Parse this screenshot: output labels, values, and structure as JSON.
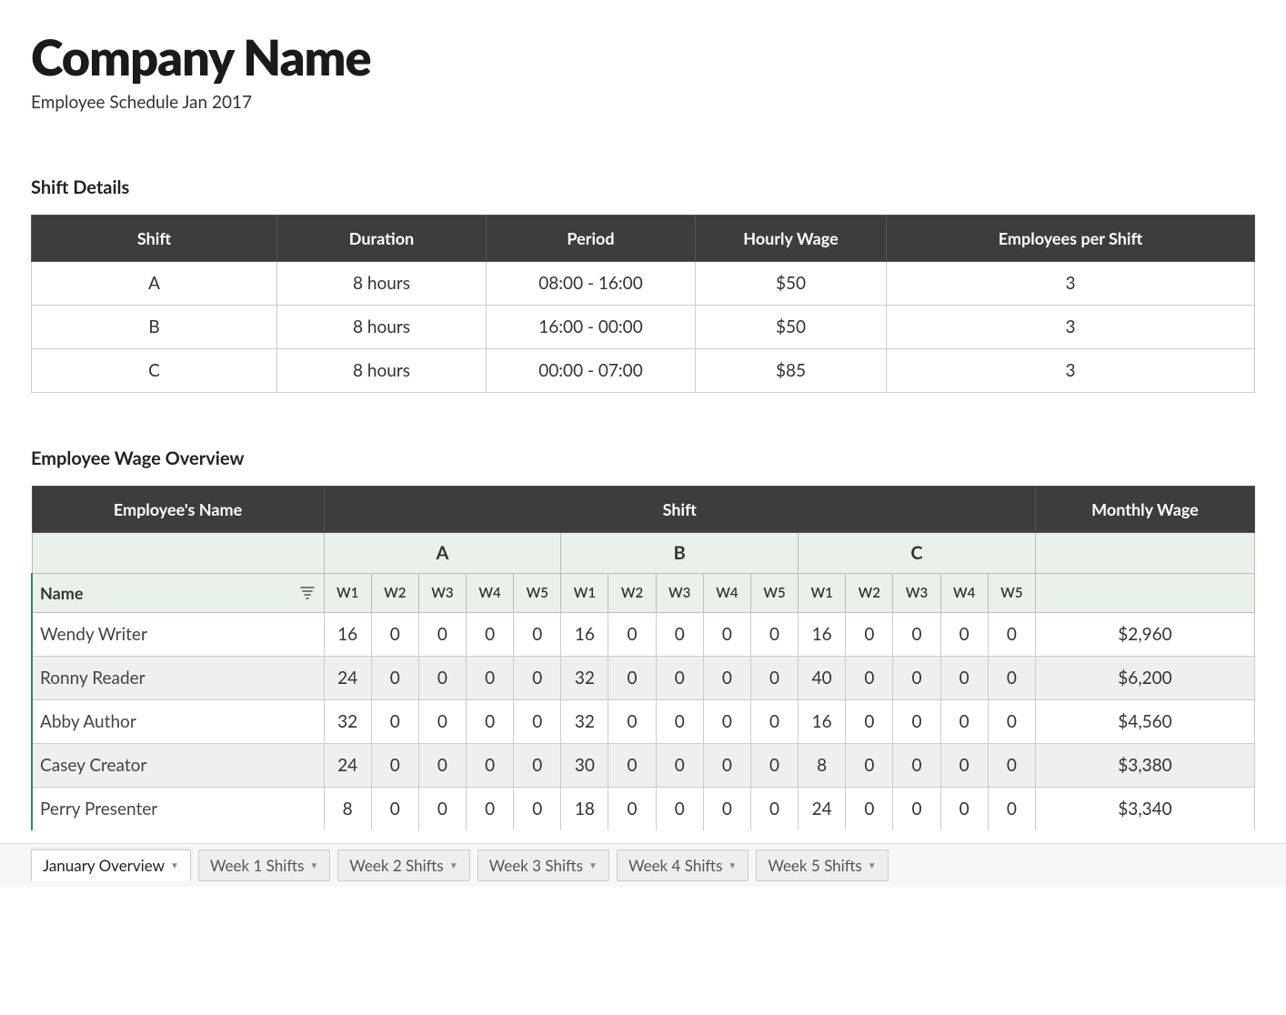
{
  "header": {
    "company": "Company Name",
    "subtitle": "Employee Schedule Jan 2017"
  },
  "shift_details": {
    "title": "Shift Details",
    "headers": [
      "Shift",
      "Duration",
      "Period",
      "Hourly Wage",
      "Employees per Shift"
    ],
    "rows": [
      {
        "shift": "A",
        "duration": "8 hours",
        "period": "08:00 - 16:00",
        "wage": "$50",
        "emp": "3"
      },
      {
        "shift": "B",
        "duration": "8 hours",
        "period": "16:00 - 00:00",
        "wage": "$50",
        "emp": "3"
      },
      {
        "shift": "C",
        "duration": "8 hours",
        "period": "00:00 - 07:00",
        "wage": "$85",
        "emp": "3"
      }
    ]
  },
  "wage_overview": {
    "title": "Employee Wage Overview",
    "main_headers": {
      "name": "Employee's Name",
      "shift": "Shift",
      "wage": "Monthly Wage"
    },
    "shift_groups": [
      "A",
      "B",
      "C"
    ],
    "name_label": "Name",
    "week_labels": [
      "W1",
      "W2",
      "W3",
      "W4",
      "W5"
    ],
    "rows": [
      {
        "name": "Wendy Writer",
        "a": [
          "16",
          "0",
          "0",
          "0",
          "0"
        ],
        "b": [
          "16",
          "0",
          "0",
          "0",
          "0"
        ],
        "c": [
          "16",
          "0",
          "0",
          "0",
          "0"
        ],
        "wage": "$2,960"
      },
      {
        "name": "Ronny Reader",
        "a": [
          "24",
          "0",
          "0",
          "0",
          "0"
        ],
        "b": [
          "32",
          "0",
          "0",
          "0",
          "0"
        ],
        "c": [
          "40",
          "0",
          "0",
          "0",
          "0"
        ],
        "wage": "$6,200"
      },
      {
        "name": "Abby Author",
        "a": [
          "32",
          "0",
          "0",
          "0",
          "0"
        ],
        "b": [
          "32",
          "0",
          "0",
          "0",
          "0"
        ],
        "c": [
          "16",
          "0",
          "0",
          "0",
          "0"
        ],
        "wage": "$4,560"
      },
      {
        "name": "Casey Creator",
        "a": [
          "24",
          "0",
          "0",
          "0",
          "0"
        ],
        "b": [
          "30",
          "0",
          "0",
          "0",
          "0"
        ],
        "c": [
          "8",
          "0",
          "0",
          "0",
          "0"
        ],
        "wage": "$3,380"
      },
      {
        "name": "Perry Presenter",
        "a": [
          "8",
          "0",
          "0",
          "0",
          "0"
        ],
        "b": [
          "18",
          "0",
          "0",
          "0",
          "0"
        ],
        "c": [
          "24",
          "0",
          "0",
          "0",
          "0"
        ],
        "wage": "$3,340"
      }
    ]
  },
  "tabs": [
    {
      "label": "January Overview",
      "active": true
    },
    {
      "label": "Week 1 Shifts",
      "active": false
    },
    {
      "label": "Week 2 Shifts",
      "active": false
    },
    {
      "label": "Week 3 Shifts",
      "active": false
    },
    {
      "label": "Week 4 Shifts",
      "active": false
    },
    {
      "label": "Week 5 Shifts",
      "active": false
    }
  ]
}
